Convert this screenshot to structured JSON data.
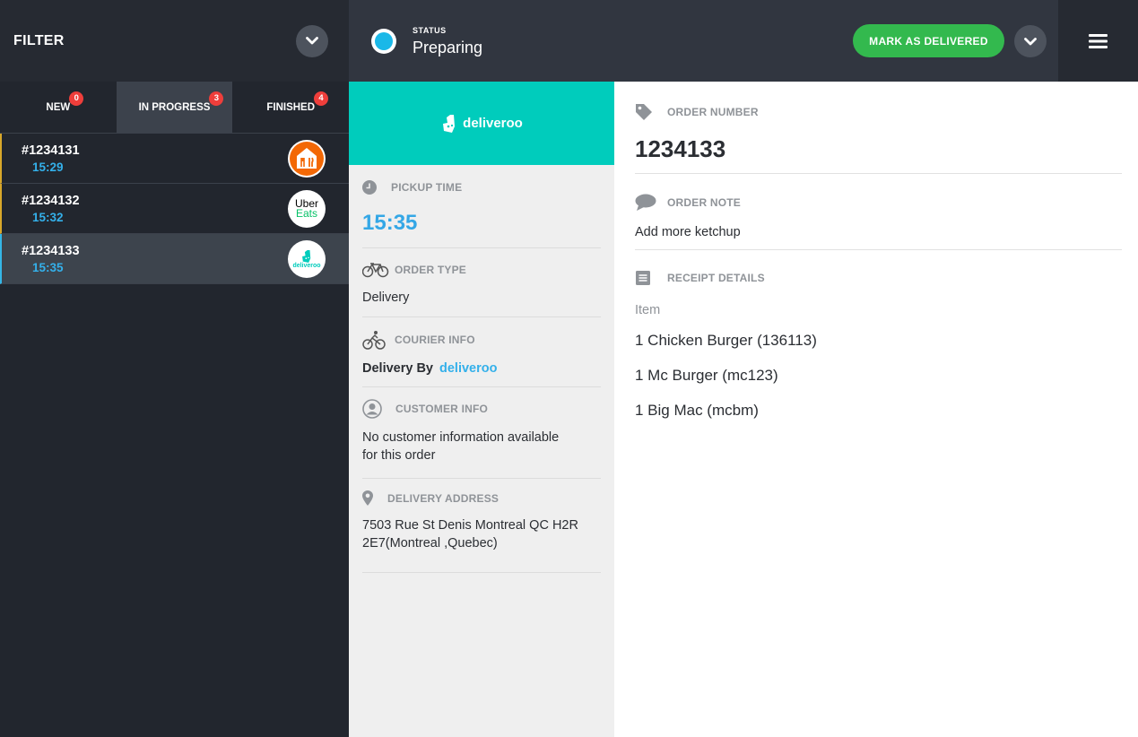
{
  "sidebar": {
    "filter_title": "FILTER",
    "tabs": [
      {
        "label": "NEW",
        "badge": "0"
      },
      {
        "label": "IN PROGRESS",
        "badge": "3"
      },
      {
        "label": "FINISHED",
        "badge": "4"
      }
    ],
    "orders": [
      {
        "number": "#1234131",
        "time": "15:29",
        "platform": "takeaway"
      },
      {
        "number": "#1234132",
        "time": "15:32",
        "platform": "uber-eats",
        "logo_line1": "Uber",
        "logo_line2": "Eats"
      },
      {
        "number": "#1234133",
        "time": "15:35",
        "platform": "deliveroo",
        "logo_text": "deliveroo"
      }
    ]
  },
  "header": {
    "status_label": "STATUS",
    "status_value": "Preparing",
    "mark_delivered": "MARK AS DELIVERED"
  },
  "middle": {
    "brand_name": "deliveroo",
    "pickup_time_label": "PICKUP TIME",
    "pickup_time": "15:35",
    "order_type_label": "ORDER TYPE",
    "order_type": "Delivery",
    "courier_label": "COURIER INFO",
    "courier_prefix": "Delivery By",
    "courier_name": "deliveroo",
    "customer_label": "CUSTOMER INFO",
    "customer_line1": "No customer information available",
    "customer_line2": "for this order",
    "address_label": "DELIVERY ADDRESS",
    "address_line1": "7503 Rue St Denis Montreal QC H2R",
    "address_line2": "2E7(Montreal ,Quebec)"
  },
  "right": {
    "order_number_label": "ORDER NUMBER",
    "order_number": "1234133",
    "order_note_label": "ORDER NOTE",
    "order_note": "Add more ketchup",
    "receipt_label": "RECEIPT DETAILS",
    "item_header": "Item",
    "items": [
      "1 Chicken Burger (136113)",
      "1 Mc Burger (mc123)",
      "1 Big Mac (mcbm)"
    ]
  },
  "colors": {
    "accent_blue": "#34b0ea",
    "deliveroo_teal": "#00ccbc",
    "success_green": "#33b94e",
    "badge_red": "#ef3e3b",
    "takeaway_orange": "#f36805",
    "uber_green": "#06c167"
  }
}
